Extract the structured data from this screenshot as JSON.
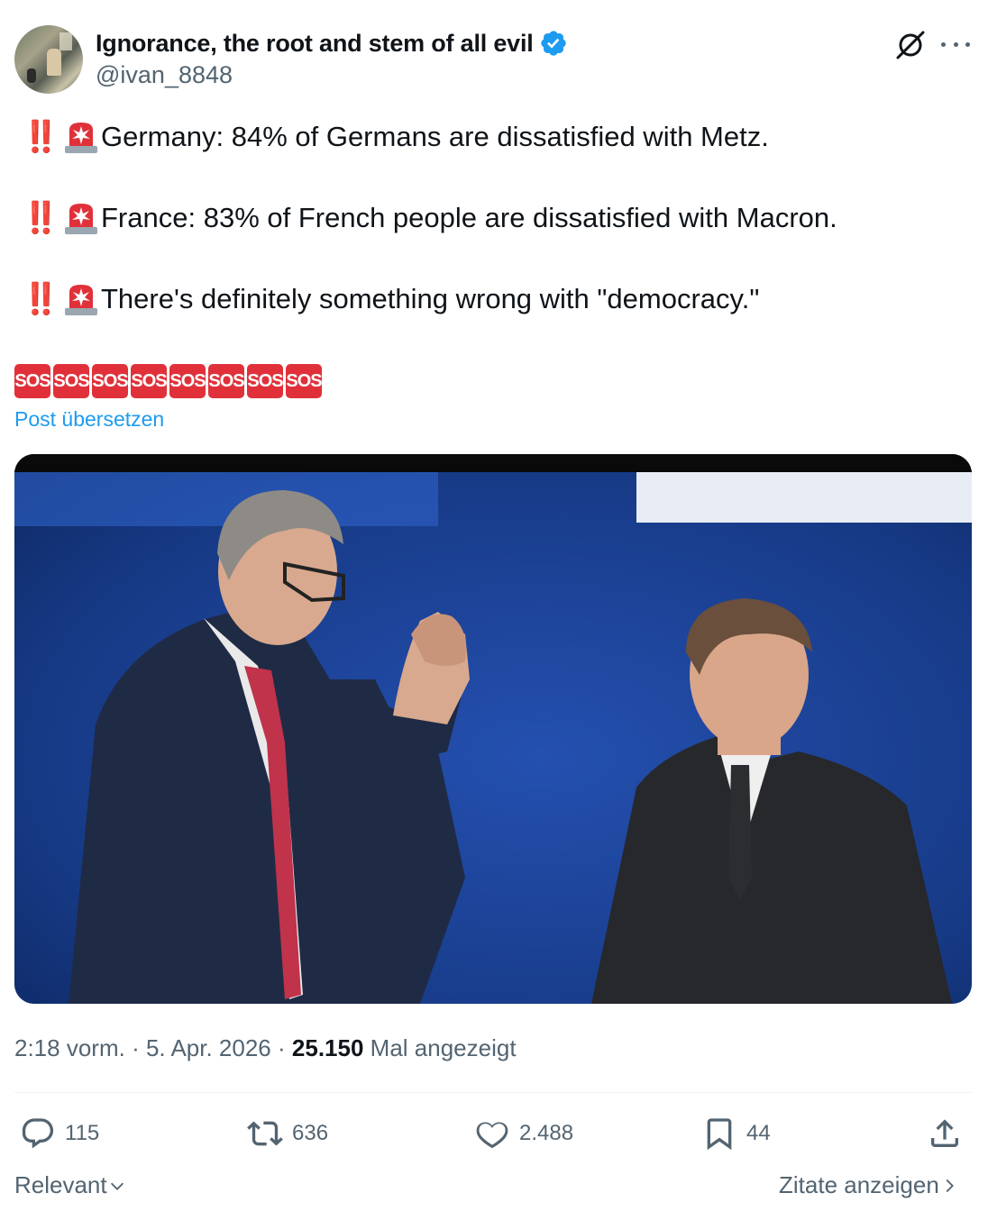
{
  "author": {
    "display_name": "Ignorance, the root and stem of all evil",
    "handle": "@ivan_8848",
    "verified": true
  },
  "icons": {
    "verified": "verified-badge-icon",
    "grok": "grok-icon",
    "more": "more-icon",
    "siren": "rotating-light-icon",
    "bang": "double-exclamation-icon",
    "sos": "sos-icon"
  },
  "post": {
    "lines": [
      {
        "bang": "‼️",
        "text": "Germany: 84% of Germans are dissatisfied with Metz."
      },
      {
        "bang": "‼️",
        "text": "France: 83% of French people are dissatisfied with Macron."
      },
      {
        "bang": "‼️",
        "text": "There's definitely something wrong with \"democracy.\""
      }
    ],
    "sos_labels": [
      "SOS",
      "SOS",
      "SOS",
      "SOS",
      "SOS",
      "SOS",
      "SOS",
      "SOS"
    ],
    "translate_label": "Post übersetzen",
    "photo_alt": "Two men on stage with a blue background"
  },
  "meta": {
    "time": "2:18 vorm.",
    "sep1": "·",
    "date": "5. Apr. 2026",
    "sep2": "·",
    "views": "25.150",
    "views_label": "Mal angezeigt"
  },
  "actions": {
    "replies": "115",
    "reposts": "636",
    "likes": "2.488",
    "bookmarks": "44"
  },
  "footer": {
    "sort_label": "Relevant",
    "quotes_label": "Zitate anzeigen"
  },
  "colors": {
    "accent": "#1d9bf0",
    "text": "#0f1419",
    "muted": "#536471",
    "sos": "#e0313a"
  }
}
